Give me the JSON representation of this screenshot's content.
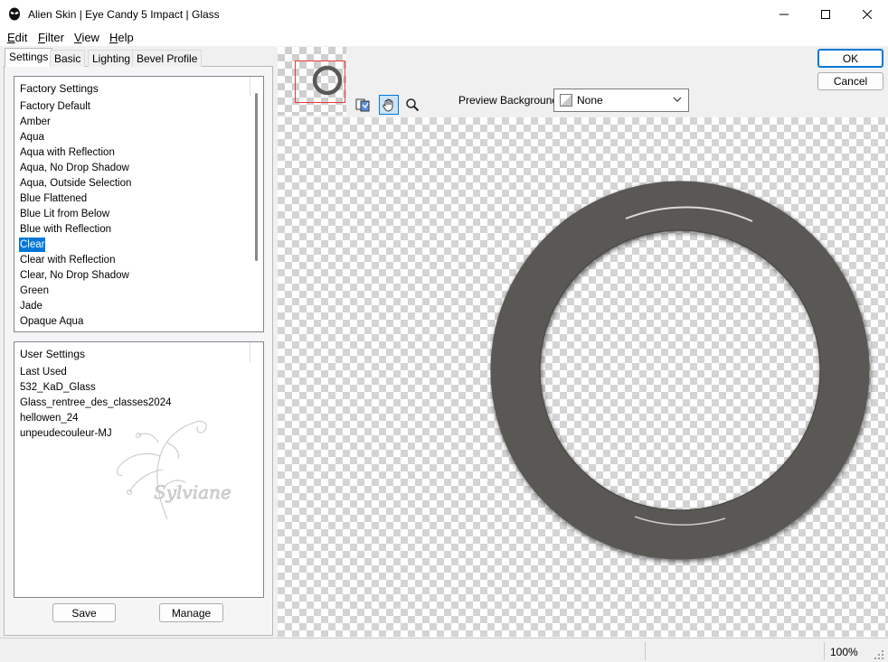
{
  "window": {
    "title": "Alien Skin | Eye Candy 5 Impact | Glass"
  },
  "menu": [
    {
      "key": "E",
      "rest": "dit"
    },
    {
      "key": "F",
      "rest": "ilter"
    },
    {
      "key": "V",
      "rest": "iew"
    },
    {
      "key": "H",
      "rest": "elp"
    }
  ],
  "tabs": [
    "Settings",
    "Basic",
    "Lighting",
    "Bevel Profile"
  ],
  "factory_settings": {
    "header": "Factory Settings",
    "items": [
      "Factory Default",
      "Amber",
      "Aqua",
      "Aqua with Reflection",
      "Aqua, No Drop Shadow",
      "Aqua, Outside Selection",
      "Blue Flattened",
      "Blue Lit from Below",
      "Blue with Reflection",
      "Clear",
      "Clear with Reflection",
      "Clear, No Drop Shadow",
      "Green",
      "Jade",
      "Opaque Aqua"
    ],
    "selected": "Clear"
  },
  "user_settings": {
    "header": "User Settings",
    "items": [
      "Last Used",
      "532_KaD_Glass",
      "Glass_rentree_des_classes2024",
      "hellowen_24",
      "unpeudecouleur-MJ"
    ]
  },
  "buttons": {
    "save": "Save",
    "manage": "Manage",
    "ok": "OK",
    "cancel": "Cancel"
  },
  "preview": {
    "bg_label": "Preview Background:",
    "bg_value": "None",
    "ring_color": "#5a5955"
  },
  "watermark_text": "Sylviane",
  "status": {
    "zoom": "100%"
  },
  "colors": {
    "accent": "#0078d7",
    "thumb_rect": "#e83a3a"
  }
}
